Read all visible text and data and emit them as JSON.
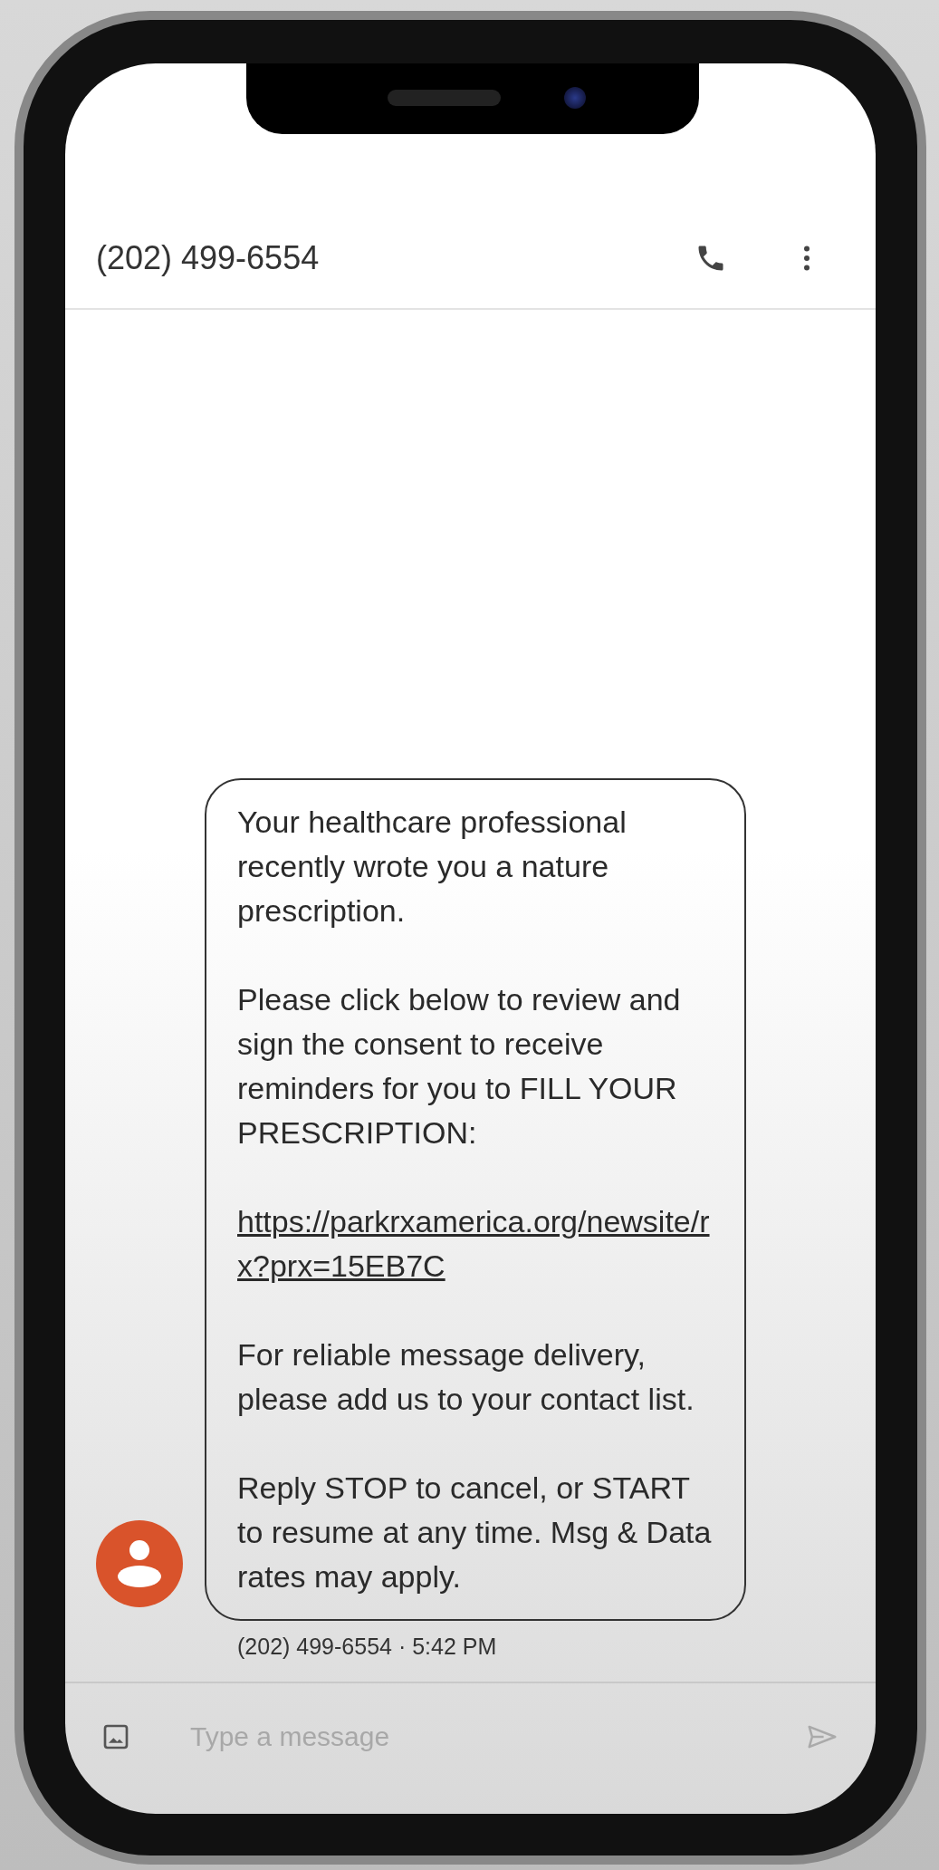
{
  "app_bar": {
    "title": "(202) 499-6554",
    "actions": [
      {
        "kind": "call"
      },
      {
        "kind": "more"
      }
    ]
  },
  "message": {
    "paragraphs": [
      {
        "kind": "text",
        "text": "Your healthcare professional recently wrote you a nature prescription."
      },
      {
        "kind": "text",
        "text": "Please click below to review and sign the consent to receive reminders for you to FILL YOUR PRESCRIPTION:"
      },
      {
        "kind": "link",
        "text": "https://parkrxamerica.org/newsite/rx?prx=15EB7C"
      },
      {
        "kind": "text",
        "text": "For reliable message delivery, please add us to your contact list."
      },
      {
        "kind": "text",
        "text": "Reply STOP to cancel, or START to resume at any time. Msg & Data rates may apply."
      }
    ],
    "meta": "(202) 499-6554 · 5:42 PM"
  },
  "composer": {
    "placeholder": "Type a message"
  }
}
